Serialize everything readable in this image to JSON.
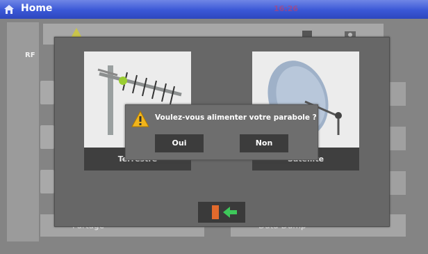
{
  "titlebar": {
    "title": "Home",
    "clock": "16:26"
  },
  "sidebar": {
    "rf_label": "RF"
  },
  "dialog": {
    "message": "Voulez-vous alimenter votre parabole ?",
    "yes_label": "Oui",
    "no_label": "Non"
  },
  "cards": {
    "terrestrial_label": "Terrestre",
    "satellite_label": "Satellite"
  },
  "bottom": {
    "left_label": "Partage",
    "right_label": "Data Dump"
  },
  "colors": {
    "titlebar": "#3a57d6",
    "panel": "#676767",
    "button": "#3c3c3c",
    "warning": "#f2b51b"
  },
  "icons": [
    "home-icon",
    "warning-icon",
    "antenna-icon",
    "satellite-dish-icon",
    "back-arrow-icon"
  ]
}
